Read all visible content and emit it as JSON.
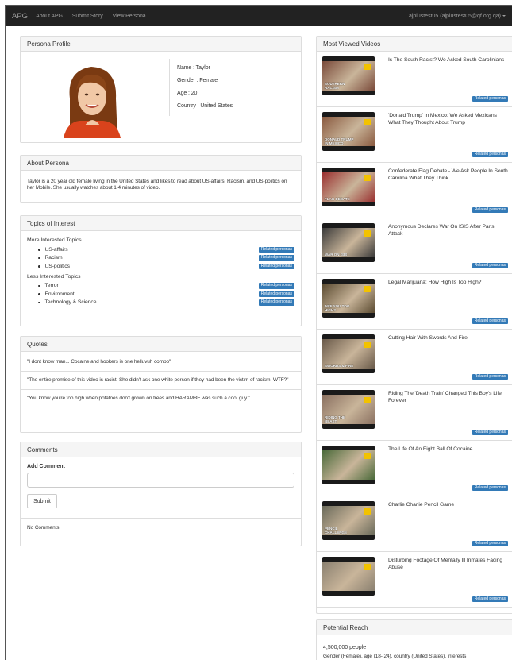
{
  "navbar": {
    "brand": "APG",
    "links": [
      "About APG",
      "Submit Story",
      "View Persona"
    ],
    "user": "ajplustest05 (ajplustest05@qf.org.qa)"
  },
  "profile": {
    "heading": "Persona Profile",
    "name": "Name : Taylor",
    "gender": "Gender : Female",
    "age": "Age : 20",
    "country": "Country : United States"
  },
  "about": {
    "heading": "About Persona",
    "text": "Taylor is a 20 year old female living in the United States and likes to read about US-affairs, Racism, and US-politics on her Mobile. She usually watches about 1.4 minutes of video."
  },
  "topics": {
    "heading": "Topics of Interest",
    "more_label": "More Interested Topics",
    "more": [
      "US-affairs",
      "Racism",
      "US-politics"
    ],
    "less_label": "Less Interested Topics",
    "less": [
      "Terror",
      "Environment",
      "Technology & Science"
    ],
    "related_label": "Related personas"
  },
  "quotes": {
    "heading": "Quotes",
    "items": [
      "\"I dont know man... Cocaine and hookers is one helluvuh combo\"",
      "\"The entire premise of this video is racist. She didn't ask one white person if they had been the victim of racism. WTF?\"",
      "\"You know you're too high when potatoes don't grown on trees and HARAMBE was such a coo, guy.\""
    ]
  },
  "comments": {
    "heading": "Comments",
    "add_label": "Add Comment",
    "input_value": "",
    "submit_label": "Submit",
    "empty_text": "No Comments"
  },
  "videos": {
    "heading": "Most Viewed Videos",
    "related_label": "Related personas",
    "items": [
      {
        "title": "Is The South Racist? We Asked South Carolinians",
        "caption": "Southern Racism",
        "art": "#7a4a3a"
      },
      {
        "title": "'Donald Trump' In Mexico: We Asked Mexicans What They Thought About Trump",
        "caption": "Donald Trump In Mexico",
        "art": "#8a5a40"
      },
      {
        "title": "Confederate Flag Debate - We Ask People In South Carolina What They Think",
        "caption": "Flag Debate",
        "art": "#9a3030"
      },
      {
        "title": "Anonymous Declares War On ISIS After Paris Attack",
        "caption": "War On ISIS",
        "art": "#3a3a3a"
      },
      {
        "title": "Legal Marijuana: How High Is Too High?",
        "caption": "Are You Too High?",
        "art": "#5a4a30"
      },
      {
        "title": "Cutting Hair With Swords And Fire",
        "caption": "Swords & Fire",
        "art": "#6a5a4a"
      },
      {
        "title": "Riding The 'Death Train' Changed This Boy's Life Forever",
        "caption": "Riding The Beast",
        "art": "#8a7060"
      },
      {
        "title": "The Life Of An Eight Ball Of Cocaine",
        "caption": "",
        "art": "#4a6a3a"
      },
      {
        "title": "Charlie Charlie Pencil Game",
        "caption": "Pencil Challenge",
        "art": "#6a6a5a"
      },
      {
        "title": "Disturbing Footage Of Mentally Ill Inmates Facing Abuse",
        "caption": "",
        "art": "#8a8070"
      }
    ]
  },
  "reach": {
    "heading": "Potential Reach",
    "count": "4,500,000 people",
    "details": "Gender (Female), age (18- 24), country (United States), interests"
  },
  "colors": {
    "navbar": "#222222",
    "primary_button": "#337ab7",
    "panel_heading": "#f5f5f5"
  }
}
